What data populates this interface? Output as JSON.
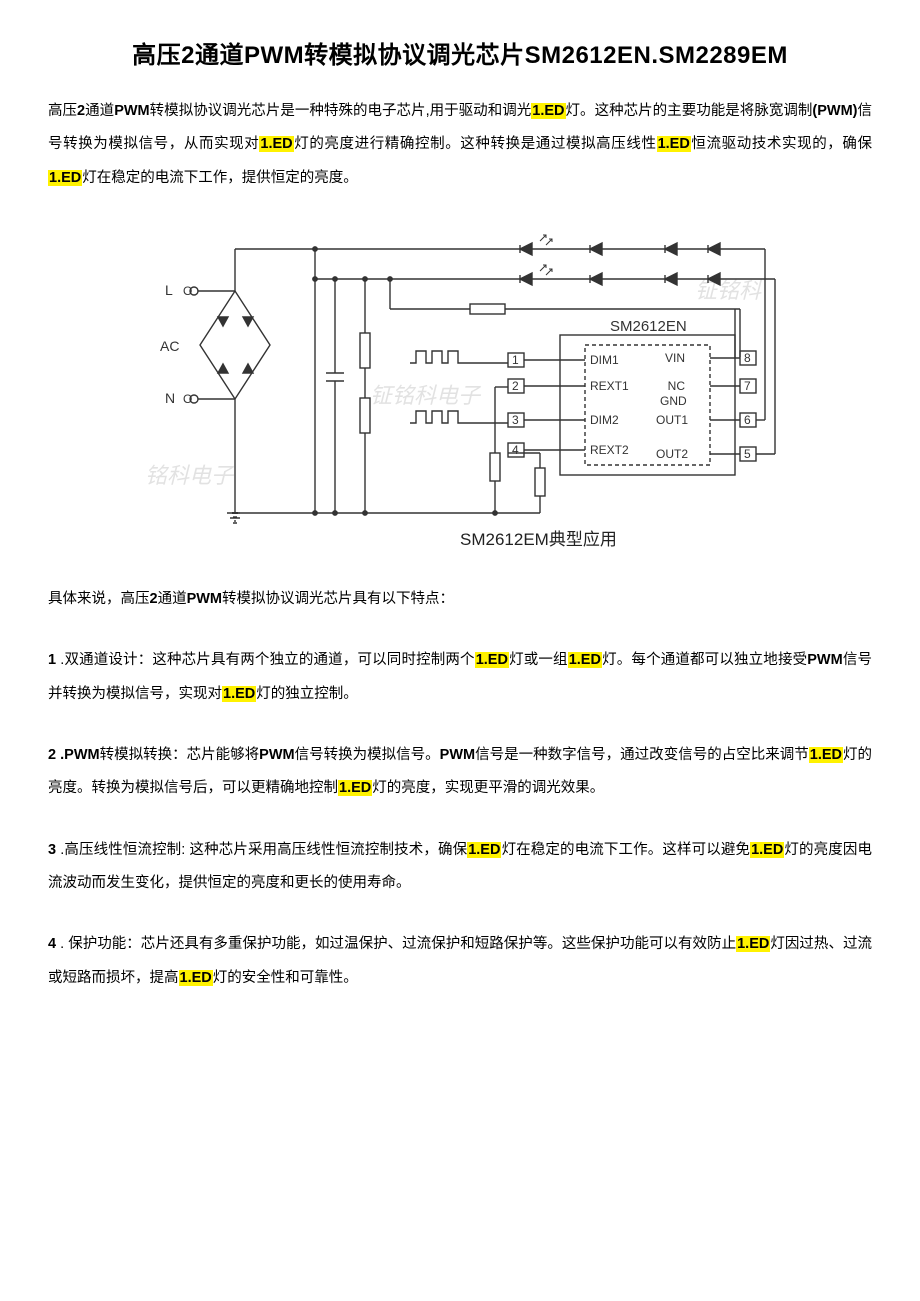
{
  "title": "高压2通道PWM转模拟协议调光芯片SM2612EN.SM2289EM",
  "intro": {
    "t1": "高压",
    "t2": "2",
    "t3": "通道",
    "pwm": "PWM",
    "t4": "转模拟协议调光芯片是一种特殊的电子芯片,用于驱动和调光",
    "led1": "1.ED",
    "t5": "灯。这种芯片的主要功能是将脉宽调制",
    "pwm2": "(PWM)",
    "t6": "信号转换为模拟信号，从而实现对",
    "t7": "灯的亮度进行精确控制。这种转换是通过模拟高压线性",
    "t8": "恒流驱动技术实现的，确保",
    "t9": "灯在稳定的电流下工作，提供恒定的亮度。"
  },
  "diagram": {
    "ac_top": "L",
    "ac_bot": "N",
    "ac_mid": "AC",
    "chip": "SM2612EN",
    "pins_left": [
      {
        "n": "1",
        "name": "DIM1"
      },
      {
        "n": "2",
        "name": "REXT1"
      },
      {
        "n": "3",
        "name": "DIM2"
      },
      {
        "n": "4",
        "name": "REXT2"
      }
    ],
    "pins_right": [
      {
        "n": "8",
        "name": "VIN"
      },
      {
        "n": "7",
        "name": "NC"
      },
      {
        "n": "6",
        "name": "OUT1"
      },
      {
        "n": "5",
        "name": "OUT2"
      }
    ],
    "gnd": "GND",
    "wm1": "铭科电子",
    "wm2": "钲铭科电子",
    "wm3": "钲铭科",
    "caption": "SM2612EM典型应用"
  },
  "features_intro": {
    "a": "具体来说，高压",
    "b": "2",
    "c": "通道",
    "d": "PWM",
    "e": "转模拟协议调光芯片具有以下特点："
  },
  "features": {
    "f1": {
      "n": "1",
      "t1": " .双通道设计：这种芯片具有两个独立的通道，可以同时控制两个",
      "t2": "灯或一组",
      "t3": "灯。每个通道都可以独立地接受",
      "pwm": "PWM",
      "t4": "信号并转换为模拟信号，实现对",
      "t5": "灯的独立控制。"
    },
    "f2": {
      "n": "2",
      "t1": " .PWM",
      "t2": "转模拟转换：芯片能够将",
      "pwm": "PWM",
      "t3": "信号转换为模拟信号。",
      "t4": "信号是一种数字信号，通过改变信号的占空比来调节",
      "t5": "灯的亮度。转换为模拟信号后，可以更精确地控制",
      "t6": "灯的亮度，实现更平滑的调光效果。"
    },
    "f3": {
      "n": "3",
      "t1": " .高压线性恒流控制: 这种芯片采用高压线性恒流控制技术，确保",
      "t2": "灯在稳定的电流下工作。这样可以避免",
      "t3": "灯的亮度因电流波动而发生变化，提供恒定的亮度和更长的使用寿命。"
    },
    "f4": {
      "n": "4",
      "t1": " . 保护功能：芯片还具有多重保护功能，如过温保护、过流保护和短路保护等。这些保护功能可以有效防止",
      "t2": "灯因过热、过流或短路而损坏，提高",
      "t3": "灯的安全性和可靠性。"
    }
  },
  "led": "1.ED",
  "circle": "O"
}
